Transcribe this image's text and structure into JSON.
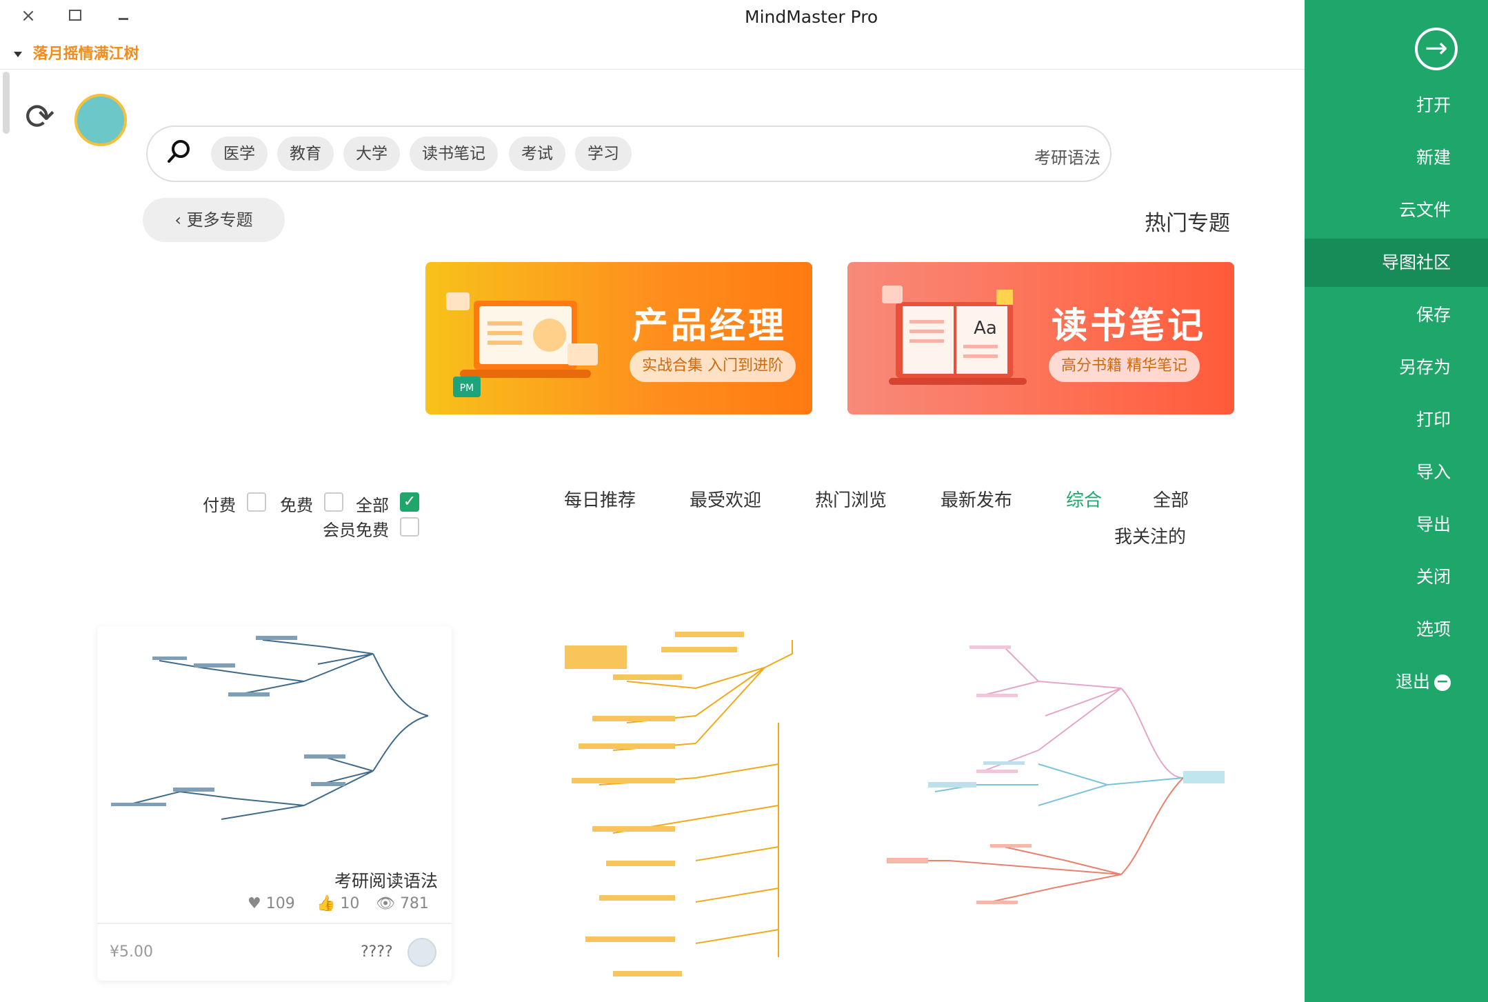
{
  "app": {
    "title": "MindMaster Pro",
    "user_name": "落月摇情满江树"
  },
  "window": {
    "close": "×"
  },
  "sidebar": {
    "open_icon": "→",
    "items": [
      {
        "label": "打开"
      },
      {
        "label": "新建"
      },
      {
        "label": "云文件"
      },
      {
        "label": "导图社区",
        "active": true
      },
      {
        "label": "保存"
      },
      {
        "label": "另存为"
      },
      {
        "label": "打印"
      },
      {
        "label": "导入"
      },
      {
        "label": "导出"
      },
      {
        "label": "关闭"
      },
      {
        "label": "选项"
      },
      {
        "label": "退出"
      }
    ]
  },
  "search": {
    "text": "考研语法",
    "tags": [
      "学习",
      "考试",
      "读书笔记",
      "大学",
      "教育",
      "医学"
    ]
  },
  "topics": {
    "more_label": "更多专题",
    "hot_label": "热门专题",
    "banners": [
      {
        "title": "读书笔记",
        "subtitle": "高分书籍 精华笔记",
        "icon_text": "Aa"
      },
      {
        "title": "产品经理",
        "subtitle": "实战合集 入门到进阶",
        "icon_text": "PM"
      }
    ]
  },
  "filters": {
    "tabs": [
      "全部",
      "综合",
      "最新发布",
      "热门浏览",
      "最受欢迎",
      "每日推荐"
    ],
    "active_tab": "综合",
    "follow": "我关注的",
    "price": [
      {
        "label": "全部",
        "checked": true
      },
      {
        "label": "免费",
        "checked": false
      },
      {
        "label": "付费",
        "checked": false
      },
      {
        "label": "会员免费",
        "checked": false
      }
    ]
  },
  "cards": [
    {
      "title": "考研阅读语法",
      "views": "781",
      "likes": "10",
      "favorites": "109",
      "author": "????",
      "price": "¥5.00"
    }
  ],
  "colors": {
    "sidebar": "#1ea66b",
    "accent": "#1ea66b",
    "user_name": "#f28c1e",
    "banner_pm": "#ff8e1e",
    "banner_rn": "#ff6a4b"
  }
}
